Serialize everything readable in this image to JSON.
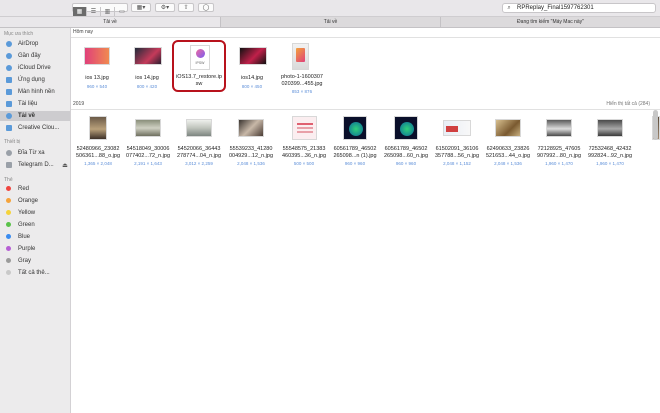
{
  "toolbar": {
    "search_value": "RPReplay_Final1597762301"
  },
  "tabs": [
    {
      "label": "Tải về",
      "active": true
    },
    {
      "label": "Tải về",
      "active": false
    },
    {
      "label": "Đang tìm kiếm \"Máy Mac này\"",
      "active": false
    }
  ],
  "sidebar": {
    "favorites_heading": "Mục ưa thích",
    "favorites": [
      {
        "label": "AirDrop"
      },
      {
        "label": "Gần đây"
      },
      {
        "label": "iCloud Drive"
      },
      {
        "label": "Ứng dụng"
      },
      {
        "label": "Màn hình nền"
      },
      {
        "label": "Tài liệu"
      },
      {
        "label": "Tải về"
      },
      {
        "label": "Creative Clou..."
      }
    ],
    "devices_heading": "Thiết bị",
    "devices": [
      {
        "label": "Đĩa Từ xa"
      },
      {
        "label": "Telegram D..."
      }
    ],
    "tags_heading": "Thẻ",
    "tags": [
      {
        "label": "Red",
        "color": "#f0453f"
      },
      {
        "label": "Orange",
        "color": "#f5a33b"
      },
      {
        "label": "Yellow",
        "color": "#f5d33b"
      },
      {
        "label": "Green",
        "color": "#5ac24a"
      },
      {
        "label": "Blue",
        "color": "#3a8cf0"
      },
      {
        "label": "Purple",
        "color": "#b65fd4"
      },
      {
        "label": "Gray",
        "color": "#9b9b9b"
      },
      {
        "label": "Tất cả thẻ..."
      }
    ]
  },
  "today": {
    "heading": "Hôm nay",
    "items": [
      {
        "name": [
          "ios 13.jpg"
        ],
        "size": "960 × 540"
      },
      {
        "name": [
          "ios 14.jpg"
        ],
        "size": "800 × 420"
      },
      {
        "name": [
          "iOS13.7_restore.ip",
          "sw"
        ],
        "size": "1,39 GB",
        "icon_text": "IPSW"
      },
      {
        "name": [
          "ios14.jpg"
        ],
        "size": "800 × 450"
      },
      {
        "name": [
          "photo-1-1600307",
          "020399...455.jpg"
        ],
        "size": "853 × 876"
      }
    ]
  },
  "year": {
    "heading": "2019",
    "show_all": "Hiển thị tất cả (284)",
    "items": [
      {
        "name": [
          "52480966_23082",
          "506361...88_o.jpg"
        ],
        "size": "1,365 × 2,048"
      },
      {
        "name": [
          "54518049_30006",
          "077402...72_n.jpg"
        ],
        "size": "2,191 × 1,643"
      },
      {
        "name": [
          "54520066_36443",
          "278774...04_n.jpg"
        ],
        "size": "3,012 × 2,259"
      },
      {
        "name": [
          "55539233_41280",
          "004929...12_n.jpg"
        ],
        "size": "2,048 × 1,536"
      },
      {
        "name": [
          "55548575_21383",
          "460395...36_n.jpg"
        ],
        "size": "500 × 500"
      },
      {
        "name": [
          "60561789_46502",
          "265098...n (1).jpg"
        ],
        "size": "960 × 960"
      },
      {
        "name": [
          "60561789_46502",
          "265098...60_n.jpg"
        ],
        "size": "960 × 960"
      },
      {
        "name": [
          "61502091_36106",
          "357788...56_n.jpg"
        ],
        "size": "2,048 × 1,152"
      },
      {
        "name": [
          "62490633_23826",
          "521653...44_o.jpg"
        ],
        "size": "2,048 × 1,536"
      },
      {
        "name": [
          "72128925_47605",
          "907992...80_n.jpg"
        ],
        "size": "1,960 × 1,470"
      },
      {
        "name": [
          "72532468_42432",
          "992824...92_n.jpg"
        ],
        "size": "1,960 × 1,470"
      }
    ]
  }
}
